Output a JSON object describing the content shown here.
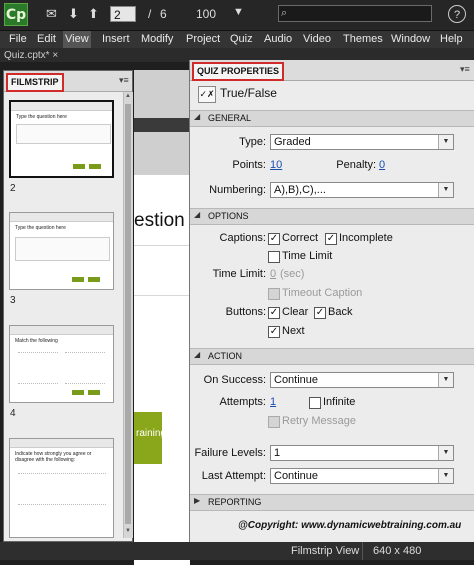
{
  "toolbar": {
    "logo": "Cp",
    "current_slide": "2",
    "slide_separator": "/",
    "total_slides": "6",
    "zoom": "100"
  },
  "menu": [
    "File",
    "Edit",
    "View",
    "Insert",
    "Modify",
    "Project",
    "Quiz",
    "Audio",
    "Video",
    "Themes",
    "Window",
    "Help"
  ],
  "tab": {
    "label": "Quiz.cptx*",
    "close": "×"
  },
  "filmstrip": {
    "title": "FILMSTRIP",
    "slides": [
      {
        "number": "2",
        "title": "Type the question here"
      },
      {
        "number": "3",
        "title": "Type the question here"
      },
      {
        "number": "4",
        "title": "Match the following"
      },
      {
        "number": "",
        "title": "Indicate how strongly you agree or disagree with the following:"
      }
    ]
  },
  "stage": {
    "text": "estion",
    "green_text": "raining."
  },
  "quiz": {
    "title": "QUIZ PROPERTIES",
    "type_label": "True/False",
    "general": {
      "section": "GENERAL",
      "type_label": "Type:",
      "type_value": "Graded",
      "points_label": "Points:",
      "points_value": "10",
      "penalty_label": "Penalty:",
      "penalty_value": "0",
      "numbering_label": "Numbering:",
      "numbering_value": "A),B),C),..."
    },
    "options": {
      "section": "OPTIONS",
      "captions_label": "Captions:",
      "correct": "Correct",
      "incomplete": "Incomplete",
      "time_limit": "Time Limit",
      "time_limit_label": "Time Limit:",
      "time_limit_value": "0",
      "time_limit_unit": "(sec)",
      "timeout_caption": "Timeout Caption",
      "buttons_label": "Buttons:",
      "clear": "Clear",
      "back": "Back",
      "next": "Next"
    },
    "action": {
      "section": "ACTION",
      "on_success_label": "On Success:",
      "on_success_value": "Continue",
      "attempts_label": "Attempts:",
      "attempts_value": "1",
      "infinite": "Infinite",
      "retry_message": "Retry Message",
      "failure_levels_label": "Failure Levels:",
      "failure_levels_value": "1",
      "last_attempt_label": "Last Attempt:",
      "last_attempt_value": "Continue"
    },
    "reporting": {
      "section": "REPORTING"
    },
    "copyright": "@Copyright: www.dynamicwebtraining.com.au"
  },
  "status": {
    "view": "Filmstrip View",
    "size": "640 x 480"
  }
}
